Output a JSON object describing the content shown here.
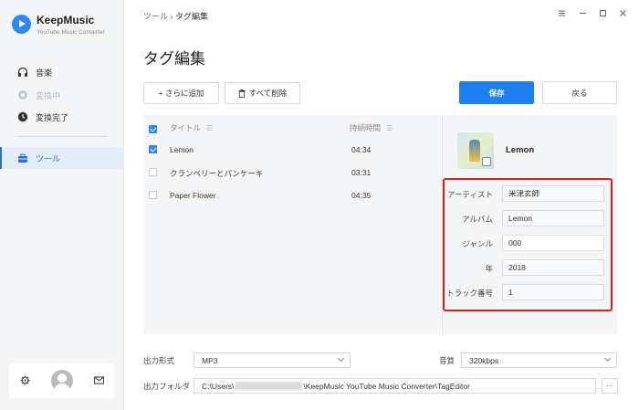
{
  "app": {
    "brand": "KeepMusic",
    "subtitle": "YouTube Music Converter"
  },
  "sidebar": {
    "items": [
      {
        "label": "音楽",
        "icon": "headphones-icon"
      },
      {
        "label": "変換中",
        "icon": "converting-icon"
      },
      {
        "label": "変換完了",
        "icon": "clock-icon"
      },
      {
        "label": "ツール",
        "icon": "toolbox-icon"
      }
    ],
    "bottom_icons": [
      "settings-icon",
      "avatar",
      "mail-icon"
    ]
  },
  "header": {
    "breadcrumb_root": "ツール",
    "breadcrumb_sep": "›",
    "breadcrumb_current": "タグ編集",
    "window_controls": [
      "menu-icon",
      "minimize-icon",
      "maximize-icon",
      "close-icon"
    ]
  },
  "page": {
    "title": "タグ編集",
    "add_more": "+ さらに追加",
    "delete_all": "すべて削除",
    "save": "保存",
    "back": "戻る"
  },
  "table": {
    "col_title": "タイトル",
    "col_duration": "持続時間",
    "rows": [
      {
        "title": "Lemon",
        "duration": "04:34",
        "checked": true
      },
      {
        "title": "クランベリーとパンケーキ",
        "duration": "03:31",
        "checked": false
      },
      {
        "title": "Paper Flower",
        "duration": "04:35",
        "checked": false
      }
    ]
  },
  "detail": {
    "track_name": "Lemon",
    "fields": [
      {
        "label": "アーティスト",
        "value": "米津玄師"
      },
      {
        "label": "アルバム",
        "value": "Lemon"
      },
      {
        "label": "ジャンル",
        "value": "000"
      },
      {
        "label": "年",
        "value": "2018"
      },
      {
        "label": "トラック番号",
        "value": "1"
      }
    ]
  },
  "settings": {
    "format_label": "出力形式",
    "format_value": "MP3",
    "quality_label": "音質",
    "quality_value": "320kbps",
    "folder_label": "出力フォルダ",
    "folder_prefix": "C:\\Users\\",
    "folder_suffix": "\\KeepMusic YouTube Music Converter\\TagEditor",
    "browse": "···"
  },
  "colors": {
    "accent": "#1e7ff0",
    "highlight": "#d92020"
  }
}
